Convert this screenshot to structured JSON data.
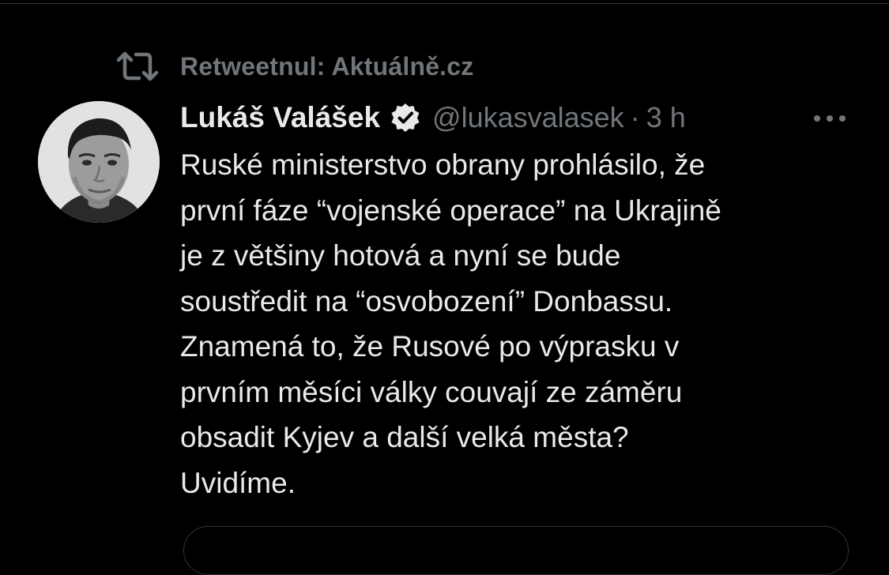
{
  "retweet": {
    "icon": "retweet-icon",
    "label": "Retweetnul: Aktuálně.cz"
  },
  "tweet": {
    "author": {
      "display_name": "Lukáš Valášek",
      "handle": "@lukasvalasek",
      "verified_icon": "verified-badge-icon",
      "avatar": "profile-photo"
    },
    "separator": "·",
    "time": "3 h",
    "more_icon": "more-options-icon",
    "text_lines": [
      "Ruské ministerstvo obrany prohlásilo, že",
      "první fáze “vojenské operace” na Ukrajině",
      "je z většiny hotová a nyní se bude",
      "soustředit na “osvobození” Donbassu.",
      "Znamená to, že Rusové po výprasku v",
      "prvním měsíci války couvají ze záměru",
      "obsadit Kyjev a další velká města?",
      "Uvidíme."
    ]
  },
  "colors": {
    "background": "#000000",
    "primary_text": "#e7e9ea",
    "secondary_text": "#71767b",
    "border": "#2f3336"
  }
}
